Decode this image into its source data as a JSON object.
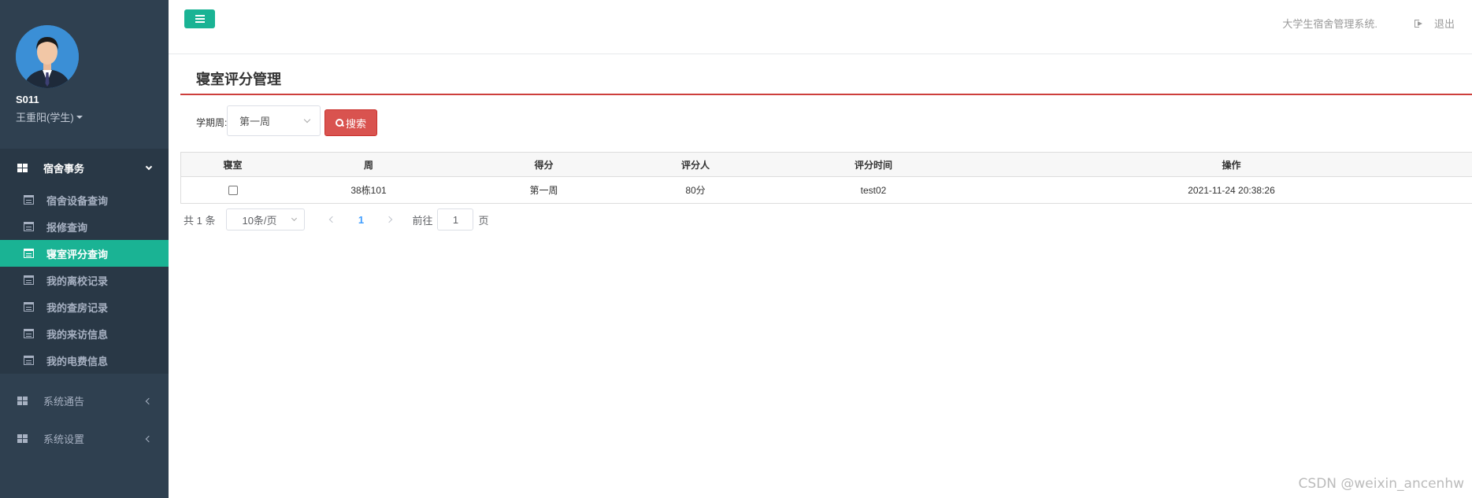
{
  "user": {
    "id": "S011",
    "name": "王重阳(学生)"
  },
  "sidebar": {
    "groups": [
      {
        "label": "宿舍事务",
        "items": [
          {
            "label": "宿舍设备查询"
          },
          {
            "label": "报修查询"
          },
          {
            "label": "寝室评分查询"
          },
          {
            "label": "我的离校记录"
          },
          {
            "label": "我的查房记录"
          },
          {
            "label": "我的来访信息"
          },
          {
            "label": "我的电费信息"
          }
        ]
      },
      {
        "label": "系统通告"
      },
      {
        "label": "系统设置"
      }
    ],
    "active_item": "寝室评分查询"
  },
  "topbar": {
    "system_name": "大学生宿舍管理系统.",
    "logout_label": "退出"
  },
  "page": {
    "title": "寝室评分管理"
  },
  "filter": {
    "label": "学期周:",
    "selected_week": "第一周",
    "search_label": "搜索"
  },
  "table": {
    "headers": [
      "寝室",
      "周",
      "得分",
      "评分人",
      "评分时间",
      "操作"
    ],
    "rows": [
      {
        "checked": false,
        "c1": "38栋101",
        "c2": "第一周",
        "c3": "80分",
        "c4": "test02",
        "c5": "2021-11-24 20:38:26"
      }
    ]
  },
  "pagination": {
    "total_text": "共 1 条",
    "page_size": "10条/页",
    "current_page": "1",
    "goto_label": "前往",
    "goto_value": "1",
    "goto_unit": "页"
  },
  "watermark": "CSDN @weixin_ancenhw",
  "colors": {
    "sidebar_bg": "#2f4050",
    "accent": "#1ab394",
    "danger": "#d9534f",
    "title_line": "#cd3f3c"
  }
}
